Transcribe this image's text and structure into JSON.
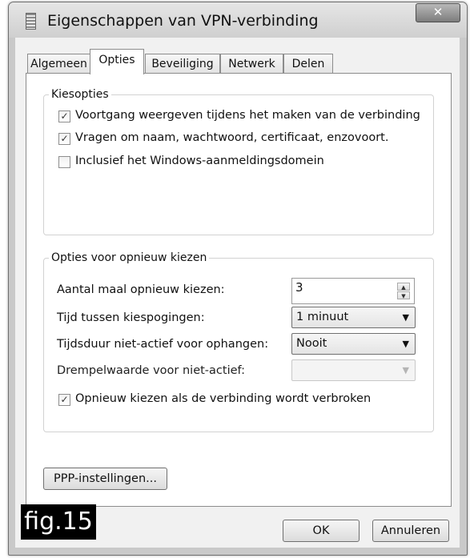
{
  "window": {
    "title": "Eigenschappen van VPN-verbinding",
    "close_symbol": "✕"
  },
  "tabs": [
    {
      "label": "Algemeen"
    },
    {
      "label": "Opties"
    },
    {
      "label": "Beveiliging"
    },
    {
      "label": "Netwerk"
    },
    {
      "label": "Delen"
    }
  ],
  "active_tab": "Opties",
  "dial_options": {
    "legend": "Kiesopties",
    "items": [
      {
        "label": "Voortgang weergeven tijdens het maken van de verbinding",
        "checked": true
      },
      {
        "label": "Vragen om naam, wachtwoord, certificaat, enzovoort.",
        "checked": true
      },
      {
        "label": "Inclusief het Windows-aanmeldingsdomein",
        "checked": false
      }
    ]
  },
  "redial_options": {
    "legend": "Opties voor opnieuw kiezen",
    "redial_count": {
      "label": "Aantal maal opnieuw kiezen:",
      "value": "3"
    },
    "time_between": {
      "label": "Tijd tussen kiespogingen:",
      "value": "1 minuut"
    },
    "idle_hangup": {
      "label": "Tijdsduur niet-actief voor ophangen:",
      "value": "Nooit"
    },
    "idle_threshold": {
      "label": "Drempelwaarde voor niet-actief:",
      "value": ""
    },
    "redial_on_drop": {
      "label": "Opnieuw kiezen als de verbinding wordt verbroken",
      "checked": true
    }
  },
  "buttons": {
    "ppp": "PPP-instellingen...",
    "ok": "OK",
    "cancel": "Annuleren"
  },
  "figure_label": "fig.15",
  "check_mark": "✓",
  "icons": {
    "spin_up": "▲",
    "spin_down": "▼",
    "dropdown": "▼"
  }
}
